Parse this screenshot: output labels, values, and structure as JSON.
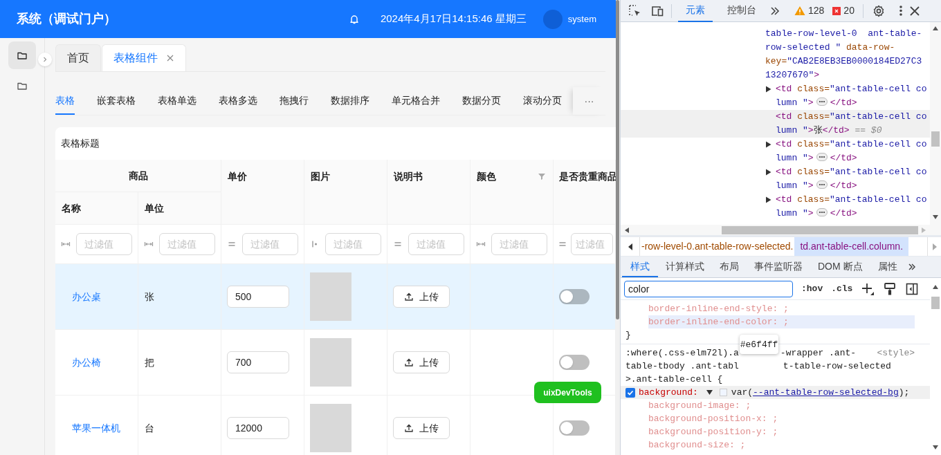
{
  "header": {
    "title": "系统（调试门户）",
    "datetime": "2024年4月17日14:15:46 星期三",
    "user": "system"
  },
  "sidebar": {
    "items": [
      {
        "selected": true
      },
      {
        "selected": false
      }
    ]
  },
  "page_tabs": [
    {
      "label": "首页",
      "selected": false,
      "closable": false
    },
    {
      "label": "表格组件",
      "selected": true,
      "closable": true
    }
  ],
  "sub_tabs": {
    "items": [
      {
        "label": "表格",
        "selected": true
      },
      {
        "label": "嵌套表格",
        "selected": false
      },
      {
        "label": "表格单选",
        "selected": false
      },
      {
        "label": "表格多选",
        "selected": false
      },
      {
        "label": "拖拽行",
        "selected": false
      },
      {
        "label": "数据排序",
        "selected": false
      },
      {
        "label": "单元格合并",
        "selected": false
      },
      {
        "label": "数据分页",
        "selected": false
      },
      {
        "label": "滚动分页",
        "selected": false
      }
    ],
    "more": "···"
  },
  "table": {
    "title": "表格标题",
    "columns": [
      {
        "label": "商品",
        "filterable": false,
        "children": [
          {
            "label": "名称",
            "filterable": false
          },
          {
            "label": "单位",
            "filterable": false
          }
        ]
      },
      {
        "label": "单价",
        "filterable": false
      },
      {
        "label": "图片",
        "filterable": false
      },
      {
        "label": "说明书",
        "filterable": false
      },
      {
        "label": "颜色",
        "filterable": true
      },
      {
        "label": "是否贵重商品",
        "filterable": false
      }
    ],
    "filters": [
      {
        "kind": "between",
        "placeholder": "过滤值"
      },
      {
        "kind": "between",
        "placeholder": "过滤值"
      },
      {
        "kind": "equals",
        "placeholder": "过滤值"
      },
      {
        "kind": "starts",
        "placeholder": "过滤值"
      },
      {
        "kind": "equals",
        "placeholder": "过滤值"
      },
      {
        "kind": "between",
        "placeholder": "过滤值"
      },
      {
        "kind": "equals",
        "placeholder": "过滤值"
      }
    ],
    "rows": [
      {
        "selected": true,
        "name": "办公桌",
        "unit": "张",
        "price": "500",
        "upload": "上传",
        "on": false
      },
      {
        "selected": false,
        "name": "办公椅",
        "unit": "把",
        "price": "700",
        "upload": "上传",
        "on": false
      },
      {
        "selected": false,
        "name": "苹果一体机",
        "unit": "台",
        "price": "12000",
        "upload": "上传",
        "on": false
      }
    ]
  },
  "float_button": "uixDevTools",
  "devtools": {
    "tabs": [
      {
        "label": "元素",
        "selected": true
      },
      {
        "label": "控制台",
        "selected": false
      }
    ],
    "warnings": "128",
    "errors": "20",
    "elements": {
      "parent": [
        {
          "kind": "value",
          "text": "table-row-level-0  ant-table-row-selected \""
        },
        {
          "kind": "attr",
          "text": " data-row-key="
        },
        {
          "kind": "value",
          "text": "\"CAB2E8EB3EB0000184ED27C313207670\""
        },
        {
          "kind": "tag",
          "text": ">"
        }
      ],
      "children": [
        {
          "expandable": true,
          "selected": false,
          "segments": [
            {
              "kind": "tag",
              "text": "<td"
            },
            {
              "kind": "attr",
              "text": " class="
            },
            {
              "kind": "value",
              "text": "\"ant-table-cell column \""
            },
            {
              "kind": "tag",
              "text": ">"
            },
            {
              "kind": "ellipsis"
            },
            {
              "kind": "tag",
              "text": "</td>"
            }
          ]
        },
        {
          "expandable": false,
          "selected": true,
          "segments": [
            {
              "kind": "tag",
              "text": "<td"
            },
            {
              "kind": "attr",
              "text": " class="
            },
            {
              "kind": "value",
              "text": "\"ant-table-cell column \""
            },
            {
              "kind": "tag",
              "text": ">"
            },
            {
              "kind": "text",
              "text": "张"
            },
            {
              "kind": "tag",
              "text": "</td>"
            },
            {
              "kind": "ref",
              "text": " == $0"
            }
          ]
        },
        {
          "expandable": true,
          "selected": false,
          "segments": [
            {
              "kind": "tag",
              "text": "<td"
            },
            {
              "kind": "attr",
              "text": " class="
            },
            {
              "kind": "value",
              "text": "\"ant-table-cell column \""
            },
            {
              "kind": "tag",
              "text": ">"
            },
            {
              "kind": "ellipsis"
            },
            {
              "kind": "tag",
              "text": "</td>"
            }
          ]
        },
        {
          "expandable": true,
          "selected": false,
          "segments": [
            {
              "kind": "tag",
              "text": "<td"
            },
            {
              "kind": "attr",
              "text": " class="
            },
            {
              "kind": "value",
              "text": "\"ant-table-cell column \""
            },
            {
              "kind": "tag",
              "text": ">"
            },
            {
              "kind": "ellipsis"
            },
            {
              "kind": "tag",
              "text": "</td>"
            }
          ]
        },
        {
          "expandable": true,
          "selected": false,
          "segments": [
            {
              "kind": "tag",
              "text": "<td"
            },
            {
              "kind": "attr",
              "text": " class="
            },
            {
              "kind": "value",
              "text": "\"ant-table-cell column \""
            },
            {
              "kind": "tag",
              "text": ">"
            },
            {
              "kind": "ellipsis"
            },
            {
              "kind": "tag",
              "text": "</td>"
            }
          ]
        }
      ]
    },
    "breadcrumbs": [
      {
        "label": "-row-level-0.ant-table-row-selected.",
        "selected": false
      },
      {
        "label": "td.ant-table-cell.column.",
        "selected": true
      }
    ],
    "style_tabs": [
      {
        "label": "样式",
        "selected": true
      },
      {
        "label": "计算样式",
        "selected": false
      },
      {
        "label": "布局",
        "selected": false
      },
      {
        "label": "事件监听器",
        "selected": false
      },
      {
        "label": "DOM 断点",
        "selected": false
      },
      {
        "label": "属性",
        "selected": false
      }
    ],
    "filter": {
      "value": "color"
    },
    "filter_buttons": [
      ":hov",
      ".cls"
    ],
    "rule_1": {
      "properties": [
        {
          "text": "border-inline-end-style: ;",
          "highlighted": false
        },
        {
          "text": "border-inline-end-color: ;",
          "highlighted": true
        }
      ],
      "close": "}"
    },
    "rule_2": {
      "selector_lines": [
        [
          ":where(.css-elm72l).a",
          "-wrapper .ant-"
        ],
        [
          "table-tbody .ant-tabl",
          "t-table-row-selected"
        ],
        [
          ">.ant-table-cell {"
        ]
      ],
      "source": "<style>",
      "declaration": {
        "checked": true,
        "property": "background:",
        "value_prefix": "var(",
        "variable": "--ant-table-row-selected-bg",
        "value_suffix": ");"
      },
      "subproperties": [
        "background-image: ;",
        "background-position-x: ;",
        "background-position-y: ;",
        "background-size: ;"
      ]
    },
    "tooltip": "#e6f4ff"
  }
}
